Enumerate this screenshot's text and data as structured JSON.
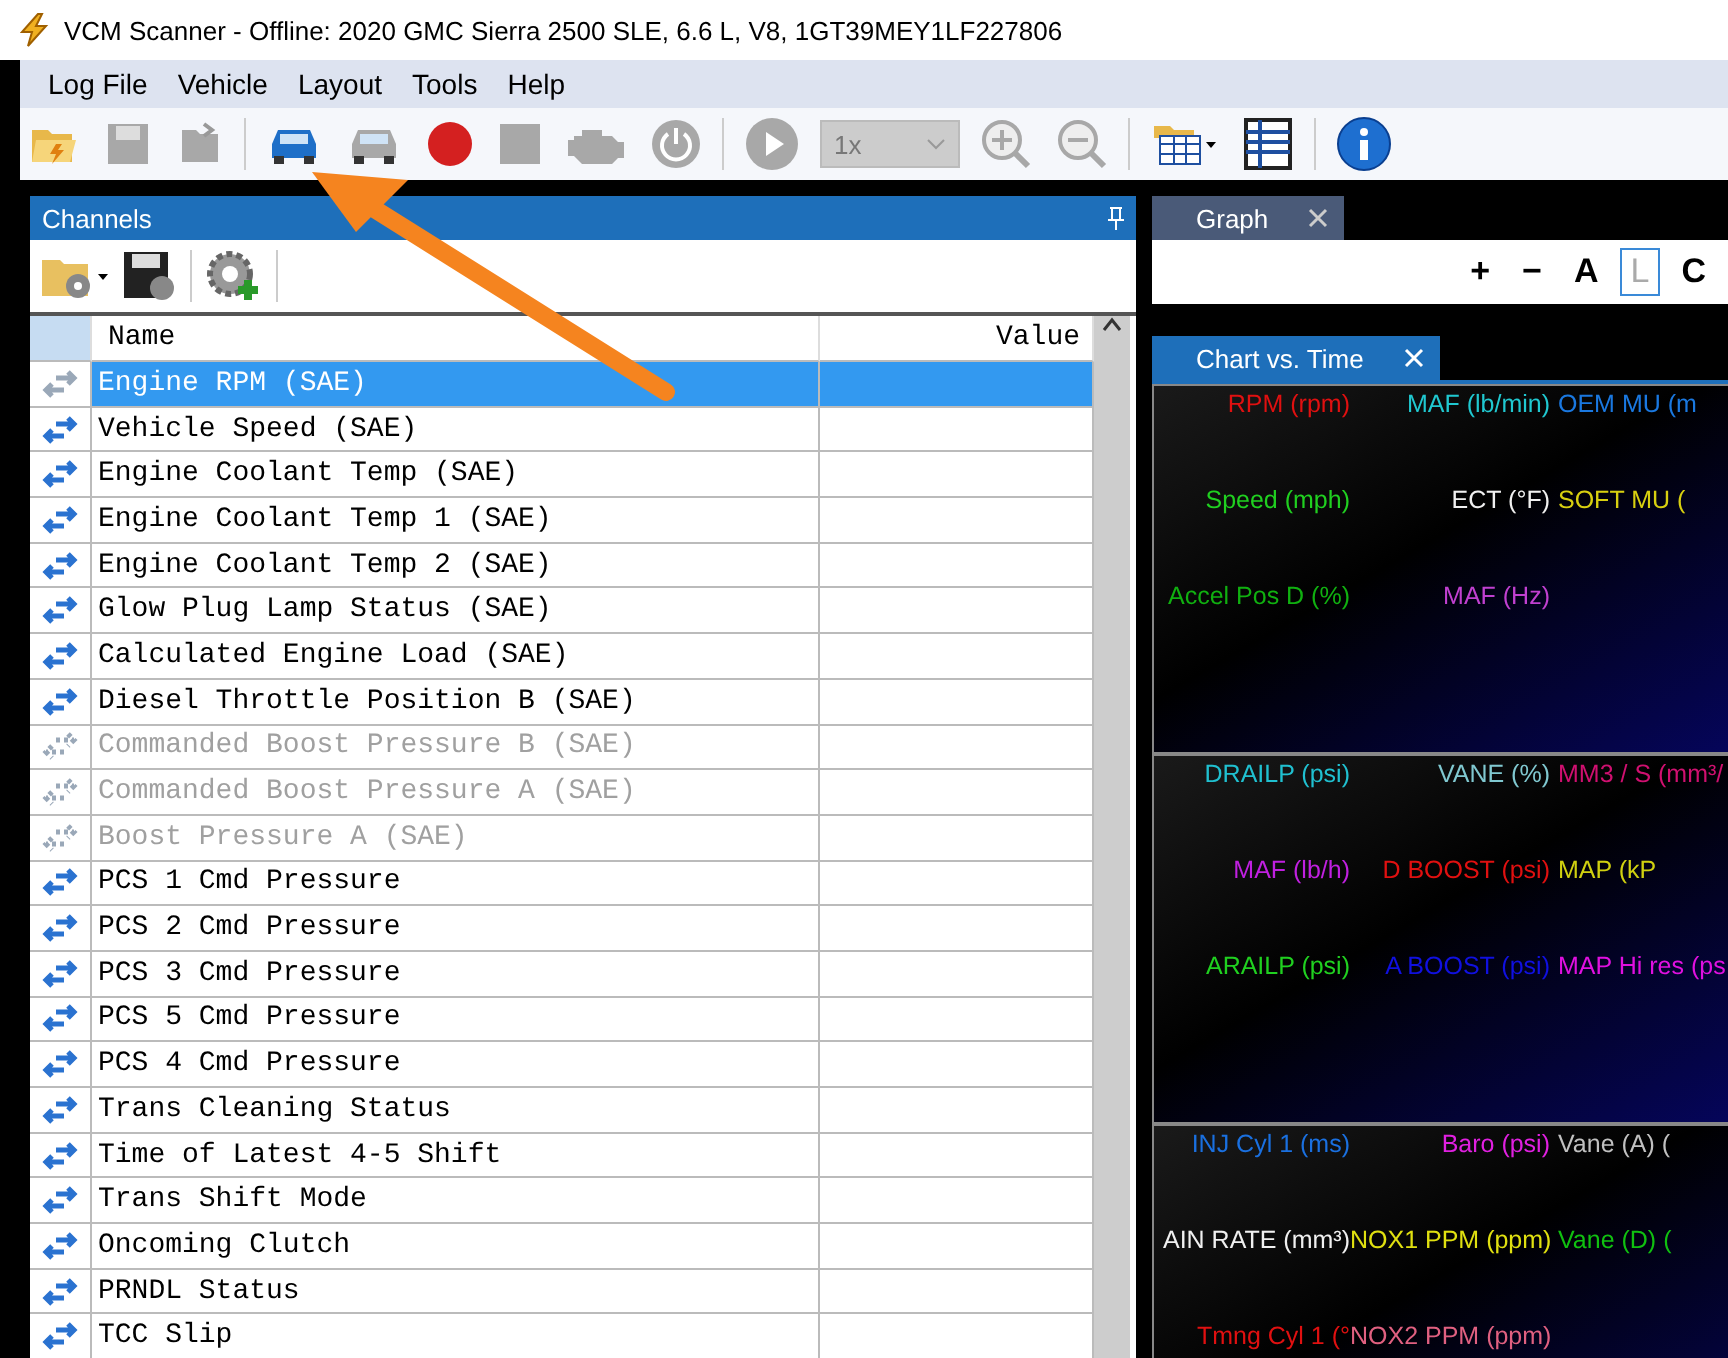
{
  "window": {
    "title": "VCM Scanner - Offline: 2020 GMC Sierra 2500 SLE, 6.6 L, V8, 1GT39MEY1LF227806"
  },
  "menu": [
    "Log File",
    "Vehicle",
    "Layout",
    "Tools",
    "Help"
  ],
  "toolbar": [
    {
      "kind": "open",
      "disabled": false
    },
    {
      "kind": "save",
      "disabled": true
    },
    {
      "kind": "export",
      "disabled": true
    },
    {
      "kind": "sep"
    },
    {
      "kind": "car",
      "disabled": false
    },
    {
      "kind": "car",
      "disabled": true
    },
    {
      "kind": "record",
      "disabled": false
    },
    {
      "kind": "stop",
      "disabled": true
    },
    {
      "kind": "engine",
      "disabled": true
    },
    {
      "kind": "power",
      "disabled": true
    },
    {
      "kind": "sep"
    },
    {
      "kind": "play",
      "disabled": true
    },
    {
      "kind": "speed",
      "value": "1x",
      "disabled": true
    },
    {
      "kind": "zoomin",
      "disabled": true
    },
    {
      "kind": "zoomout",
      "disabled": true
    },
    {
      "kind": "sep"
    },
    {
      "kind": "layout",
      "disabled": false
    },
    {
      "kind": "sheet",
      "disabled": false
    },
    {
      "kind": "sep"
    },
    {
      "kind": "info",
      "disabled": false
    }
  ],
  "channels": {
    "title": "Channels",
    "columns": [
      "Name",
      "Value"
    ],
    "rows": [
      {
        "name": "Engine RPM (SAE)",
        "selected": true,
        "disabled": false
      },
      {
        "name": "Vehicle Speed (SAE)",
        "selected": false,
        "disabled": false
      },
      {
        "name": "Engine Coolant Temp (SAE)",
        "selected": false,
        "disabled": false
      },
      {
        "name": "Engine Coolant Temp 1 (SAE)",
        "selected": false,
        "disabled": false
      },
      {
        "name": "Engine Coolant Temp 2 (SAE)",
        "selected": false,
        "disabled": false
      },
      {
        "name": "Glow Plug Lamp Status (SAE)",
        "selected": false,
        "disabled": false
      },
      {
        "name": "Calculated Engine Load (SAE)",
        "selected": false,
        "disabled": false
      },
      {
        "name": "Diesel Throttle Position B (SAE)",
        "selected": false,
        "disabled": false
      },
      {
        "name": "Commanded Boost Pressure B (SAE)",
        "selected": false,
        "disabled": true
      },
      {
        "name": "Commanded Boost Pressure A (SAE)",
        "selected": false,
        "disabled": true
      },
      {
        "name": "Boost Pressure A (SAE)",
        "selected": false,
        "disabled": true
      },
      {
        "name": "PCS 1 Cmd Pressure",
        "selected": false,
        "disabled": false
      },
      {
        "name": "PCS 2 Cmd Pressure",
        "selected": false,
        "disabled": false
      },
      {
        "name": "PCS 3 Cmd Pressure",
        "selected": false,
        "disabled": false
      },
      {
        "name": "PCS 5 Cmd Pressure",
        "selected": false,
        "disabled": false
      },
      {
        "name": "PCS 4 Cmd Pressure",
        "selected": false,
        "disabled": false
      },
      {
        "name": "Trans Cleaning Status",
        "selected": false,
        "disabled": false
      },
      {
        "name": "Time of Latest 4-5 Shift",
        "selected": false,
        "disabled": false
      },
      {
        "name": "Trans Shift Mode",
        "selected": false,
        "disabled": false
      },
      {
        "name": "Oncoming Clutch",
        "selected": false,
        "disabled": false
      },
      {
        "name": "PRNDL Status",
        "selected": false,
        "disabled": false
      },
      {
        "name": "TCC Slip",
        "selected": false,
        "disabled": false
      }
    ]
  },
  "graph": {
    "tab": "Graph",
    "tools": [
      {
        "label": "+",
        "selected": false
      },
      {
        "label": "−",
        "selected": false
      },
      {
        "label": "A",
        "selected": false
      },
      {
        "label": "L",
        "selected": true
      },
      {
        "label": "C",
        "selected": false
      }
    ]
  },
  "chart": {
    "tab": "Chart vs. Time",
    "panels": [
      {
        "labels": [
          {
            "text": "RPM (rpm)",
            "color": "#e01010"
          },
          {
            "text": "MAF (lb/min)",
            "color": "#20c8d0"
          },
          {
            "text": "OEM MU (m",
            "color": "#1a78e0"
          },
          {
            "text": "Speed (mph)",
            "color": "#20d020"
          },
          {
            "text": "ECT (°F)",
            "color": "#f0f0f0"
          },
          {
            "text": "SOFT MU (",
            "color": "#d8d010"
          },
          {
            "text": "Accel Pos D (%)",
            "color": "#10b010"
          },
          {
            "text": "MAF (Hz)",
            "color": "#c040d0"
          }
        ]
      },
      {
        "labels": [
          {
            "text": "DRAILP (psi)",
            "color": "#20c0d0"
          },
          {
            "text": "VANE (%)",
            "color": "#80c8d0"
          },
          {
            "text": "MM3 / S (mm³/",
            "color": "#d01070"
          },
          {
            "text": "MAF (lb/h)",
            "color": "#c020e0"
          },
          {
            "text": "D BOOST (psi)",
            "color": "#e01010"
          },
          {
            "text": "MAP (kP",
            "color": "#d0d010"
          },
          {
            "text": "ARAILP (psi)",
            "color": "#20d020"
          },
          {
            "text": "A BOOST (psi)",
            "color": "#1010e0"
          },
          {
            "text": "MAP Hi res (ps",
            "color": "#e010e0"
          }
        ]
      },
      {
        "labels": [
          {
            "text": "INJ Cyl 1 (ms)",
            "color": "#1a70e0"
          },
          {
            "text": "Baro (psi)",
            "color": "#e020e0"
          },
          {
            "text": "Vane (A) (",
            "color": "#c0c0c0"
          },
          {
            "text": "AIN RATE (mm³)",
            "color": "#f0f0f0"
          },
          {
            "text": "NOX1 PPM (ppm)",
            "color": "#e0e010"
          },
          {
            "text": "Vane (D) (",
            "color": "#10c010"
          },
          {
            "text": "Tmng Cyl 1 (°",
            "color": "#e01010"
          },
          {
            "text": "NOX2 PPM (ppm)",
            "color": "#e06080"
          }
        ]
      }
    ]
  }
}
